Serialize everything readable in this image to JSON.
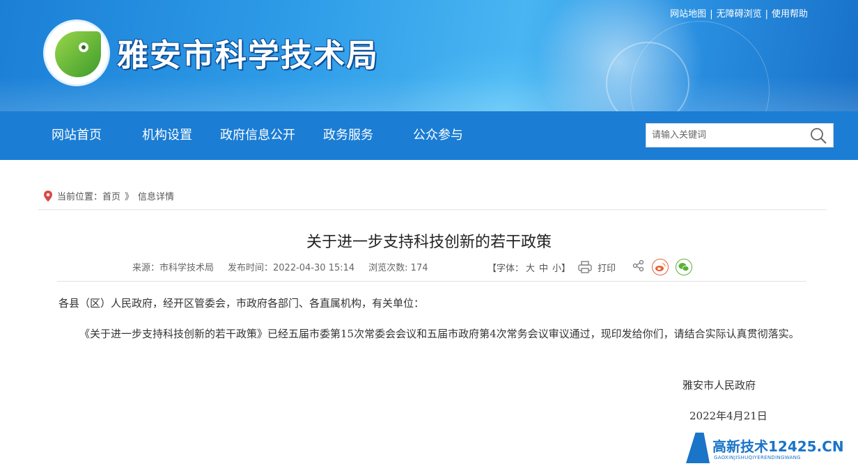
{
  "header": {
    "site_title": "雅安市科学技术局",
    "top_links": [
      "网站地图",
      "无障碍浏览",
      "使用帮助"
    ],
    "top_link_separator": "|"
  },
  "nav": {
    "items": [
      "网站首页",
      "机构设置",
      "政府信息公开",
      "政务服务",
      "公众参与"
    ],
    "search_placeholder": "请输入关键词"
  },
  "breadcrumb": {
    "prefix": "当前位置：",
    "home": "首页",
    "arrow": "》",
    "current": "信息详情"
  },
  "article": {
    "title": "关于进一步支持科技创新的若干政策",
    "source": "来源：市科学技术局",
    "publish_time": "发布时间：2022-04-30 15:14",
    "views": "浏览次数: 174",
    "font_label_open": "【字体：",
    "font_large": "大",
    "font_medium": "中",
    "font_small": "小】",
    "print_label": "打印",
    "para1": "各县（区）人民政府，经开区管委会，市政府各部门、各直属机构，有关单位：",
    "para2": "《关于进一步支持科技创新的若干政策》已经五届市委第15次常委会会议和五届市政府第4次常务会议审议通过，现印发给你们，请结合实际认真贯彻落实。",
    "signature": "雅安市人民政府",
    "date": "2022年4月21日"
  },
  "watermark": {
    "text": "高新技术",
    "number": "12425.CN",
    "sub": "GAOXINJISHUQIYERENDINGWANG"
  },
  "colors": {
    "nav_bg": "#1b7dd4",
    "header_blue": "#2f9de8",
    "weibo": "#e8613a",
    "wechat": "#5bb136"
  }
}
